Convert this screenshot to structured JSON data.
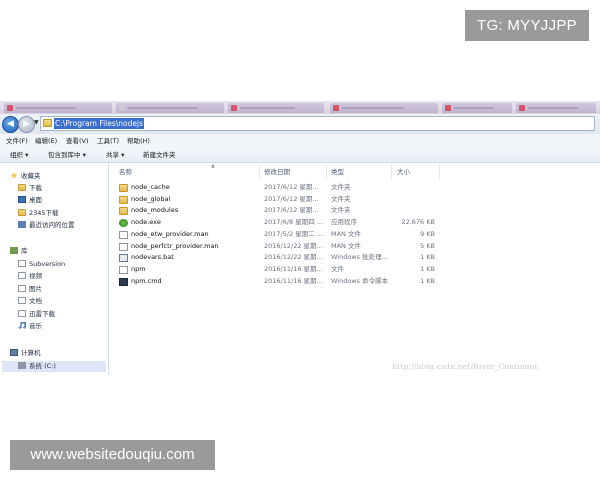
{
  "watermarks": {
    "tg": "TG: MYYJJPP",
    "site": "www.websitedouqiu.com",
    "blog": "http://blog.csdn.net/River_Continent"
  },
  "address": {
    "path": "C:\\Program Files\\nodejs"
  },
  "menubar": {
    "items": [
      "文件(F)",
      "编辑(E)",
      "查看(V)",
      "工具(T)",
      "帮助(H)"
    ]
  },
  "toolbar": {
    "items": [
      "组织 ▾",
      "包含到库中 ▾",
      "共享 ▾",
      "新建文件夹"
    ]
  },
  "navpane": {
    "favorites": "收藏夹",
    "favorite_items": [
      "下载",
      "桌面",
      "2345下载",
      "最近访问的位置"
    ],
    "library": "库",
    "library_items": [
      "Subversion",
      "视频",
      "图片",
      "文档",
      "迅雷下载",
      "音乐"
    ],
    "computer": "计算机",
    "computer_items": [
      "系统 (C:)"
    ]
  },
  "columns": {
    "name": "名称",
    "date": "修改日期",
    "type": "类型",
    "size": "大小"
  },
  "files": [
    {
      "name": "node_cache",
      "date": "2017/6/12 星期...",
      "type": "文件夹",
      "size": "",
      "icon": "folder-icon"
    },
    {
      "name": "node_global",
      "date": "2017/6/12 星期...",
      "type": "文件夹",
      "size": "",
      "icon": "folder-icon"
    },
    {
      "name": "node_modules",
      "date": "2017/6/12 星期...",
      "type": "文件夹",
      "size": "",
      "icon": "folder-icon"
    },
    {
      "name": "node.exe",
      "date": "2017/6/8 星期四 ...",
      "type": "应用程序",
      "size": "22,676 KB",
      "icon": "node-exe-icon"
    },
    {
      "name": "node_etw_provider.man",
      "date": "2017/5/2 星期二 ...",
      "type": "MAN 文件",
      "size": "9 KB",
      "icon": "file-icon"
    },
    {
      "name": "node_perfctr_provider.man",
      "date": "2016/12/22 星期...",
      "type": "MAN 文件",
      "size": "5 KB",
      "icon": "file-icon"
    },
    {
      "name": "nodevars.bat",
      "date": "2016/12/22 星期...",
      "type": "Windows 批处理...",
      "size": "1 KB",
      "icon": "batch-file-icon"
    },
    {
      "name": "npm",
      "date": "2016/11/16 星期...",
      "type": "文件",
      "size": "1 KB",
      "icon": "file-icon"
    },
    {
      "name": "npm.cmd",
      "date": "2016/11/16 星期...",
      "type": "Windows 命令脚本",
      "size": "1 KB",
      "icon": "cmd-script-icon"
    }
  ]
}
